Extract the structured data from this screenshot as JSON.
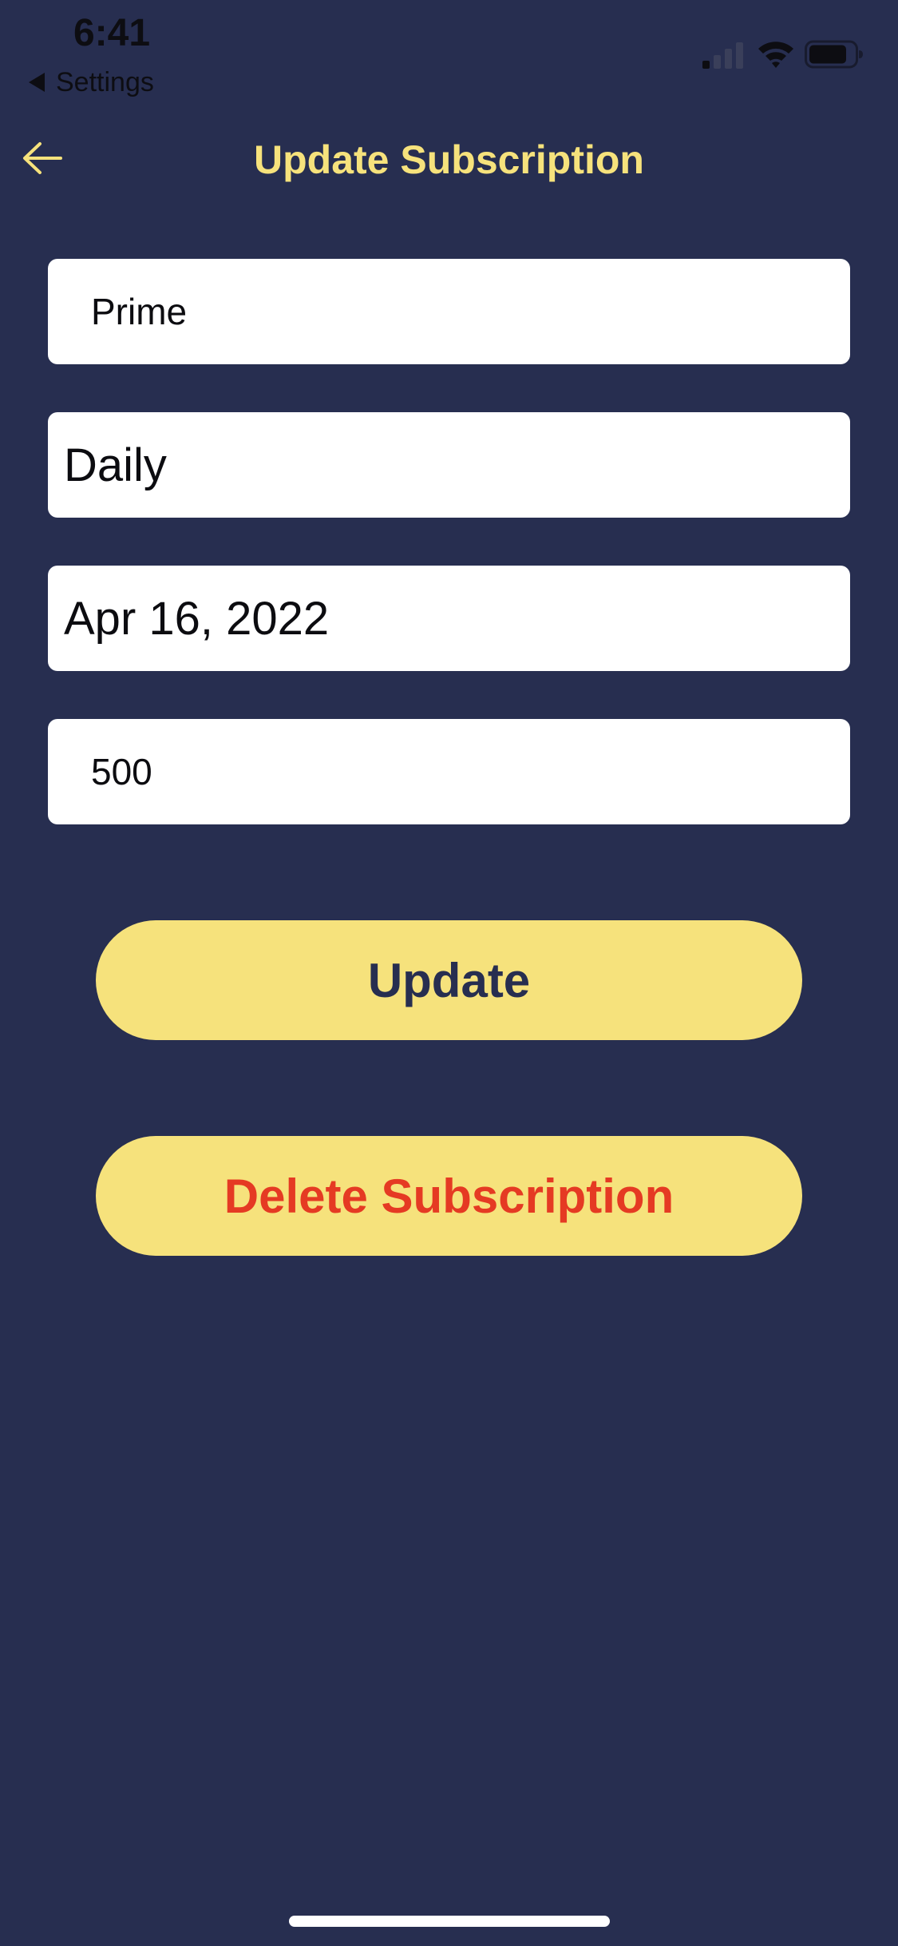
{
  "status_bar": {
    "time": "6:41",
    "back_app_label": "Settings",
    "signal_icon": "cellular-signal-icon",
    "wifi_icon": "wifi-icon",
    "battery_icon": "battery-icon"
  },
  "header": {
    "back_icon": "arrow-left-icon",
    "title": "Update Subscription"
  },
  "form": {
    "name": {
      "value": "Prime"
    },
    "frequency": {
      "value": "Daily"
    },
    "date": {
      "value": "Apr 16, 2022"
    },
    "amount": {
      "value": "500"
    }
  },
  "actions": {
    "update_label": "Update",
    "delete_label": "Delete Subscription"
  },
  "colors": {
    "background": "#272e50",
    "accent_yellow": "#f6e27c",
    "update_text": "#272e50",
    "delete_text": "#e53a23",
    "field_background": "#ffffff"
  }
}
